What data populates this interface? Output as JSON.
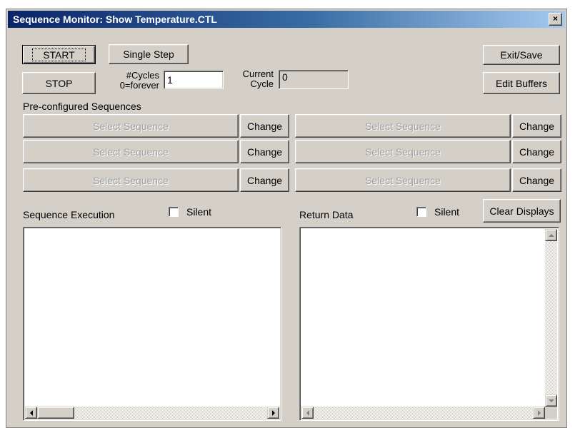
{
  "window": {
    "title": "Sequence Monitor: Show Temperature.CTL",
    "close_label": "×"
  },
  "controls": {
    "start_label": "START",
    "stop_label": "STOP",
    "single_step_label": "Single Step",
    "cycles_label_line1": "#Cycles",
    "cycles_label_line2": "0=forever",
    "cycles_value": "1",
    "current_cycle_label_line1": "Current",
    "current_cycle_label_line2": "Cycle",
    "current_cycle_value": "0",
    "exit_save_label": "Exit/Save",
    "edit_buffers_label": "Edit Buffers"
  },
  "sequences": {
    "section_label": "Pre-configured Sequences",
    "slots": [
      {
        "select_label": "Select Sequence",
        "change_label": "Change"
      },
      {
        "select_label": "Select Sequence",
        "change_label": "Change"
      },
      {
        "select_label": "Select Sequence",
        "change_label": "Change"
      },
      {
        "select_label": "Select Sequence",
        "change_label": "Change"
      },
      {
        "select_label": "Select Sequence",
        "change_label": "Change"
      },
      {
        "select_label": "Select Sequence",
        "change_label": "Change"
      }
    ]
  },
  "execution": {
    "label": "Sequence Execution",
    "silent_label": "Silent",
    "silent_checked": false
  },
  "return_data": {
    "label": "Return Data",
    "silent_label": "Silent",
    "silent_checked": false,
    "clear_label": "Clear Displays"
  },
  "colors": {
    "dialog_face": "#d4d0c8",
    "title_gradient_start": "#0a246a",
    "title_gradient_end": "#a6caf0",
    "disabled_text": "#a0a0a0"
  }
}
